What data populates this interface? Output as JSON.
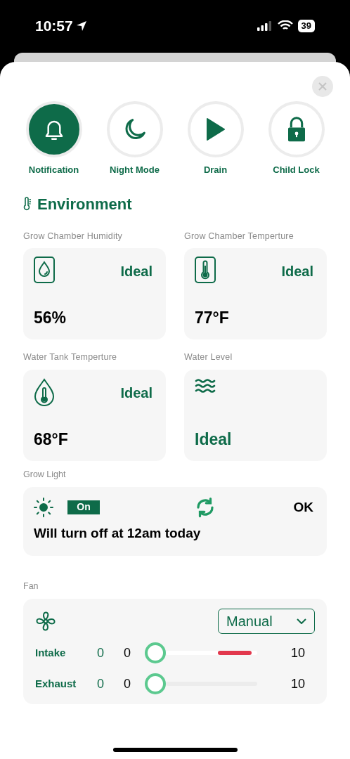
{
  "status_bar": {
    "time": "10:57",
    "battery": "39"
  },
  "quick_actions": [
    {
      "kind": "bell",
      "label": "Notification",
      "selected": true
    },
    {
      "kind": "moon",
      "label": "Night Mode",
      "selected": false
    },
    {
      "kind": "play",
      "label": "Drain",
      "selected": false
    },
    {
      "kind": "lock",
      "label": "Child Lock",
      "selected": false
    }
  ],
  "environment": {
    "title": "Environment",
    "sensors": [
      {
        "kind": "humidity",
        "label": "Grow Chamber Humidity",
        "status": "Ideal",
        "value": "56%"
      },
      {
        "kind": "thermometer",
        "label": "Grow Chamber Temperture",
        "status": "Ideal",
        "value": "77°F"
      },
      {
        "kind": "water-temp",
        "label": "Water Tank Temperture",
        "status": "Ideal",
        "value": "68°F"
      },
      {
        "kind": "water-level",
        "label": "Water Level",
        "value": "Ideal"
      }
    ]
  },
  "grow_light": {
    "label": "Grow Light",
    "state": "On",
    "status": "OK",
    "message": "Will turn off at 12am today"
  },
  "fan": {
    "label": "Fan",
    "mode": "Manual",
    "channels": [
      {
        "name": "Intake",
        "setting": "0",
        "value": "0",
        "level": 0,
        "max": "10",
        "alert": true
      },
      {
        "name": "Exhaust",
        "setting": "0",
        "value": "0",
        "level": 0,
        "max": "10",
        "alert": false
      }
    ]
  }
}
